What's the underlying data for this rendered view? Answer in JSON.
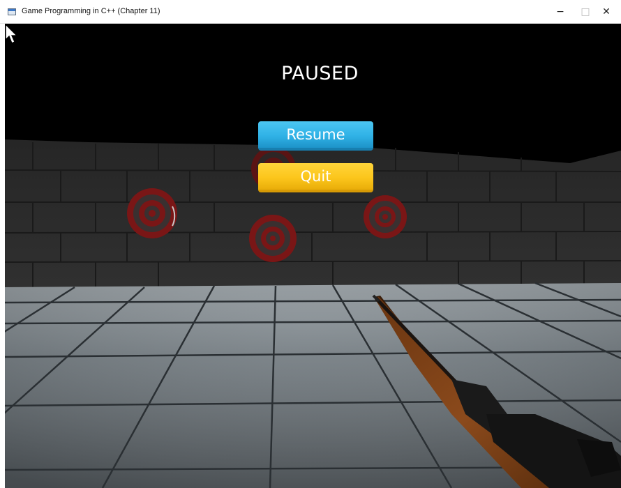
{
  "window": {
    "title": "Game Programming in C++ (Chapter 11)",
    "icon": "app-window-icon",
    "controls": {
      "minimize": "−",
      "maximize": "□",
      "close": "✕"
    }
  },
  "hud": {
    "title": "PAUSED",
    "buttons": {
      "resume": "Resume",
      "quit": "Quit"
    },
    "hovered_button": "Quit"
  },
  "scene": {
    "targets": 4,
    "icons": [
      "target-icon",
      "rifle",
      "mouse-cursor-icon"
    ]
  },
  "colors": {
    "resume_button": "#30b2e6",
    "quit_button": "#fcc61c",
    "target_red": "#8a1a1a",
    "wall": "#2a2a2a",
    "floor": "#7a838a"
  }
}
